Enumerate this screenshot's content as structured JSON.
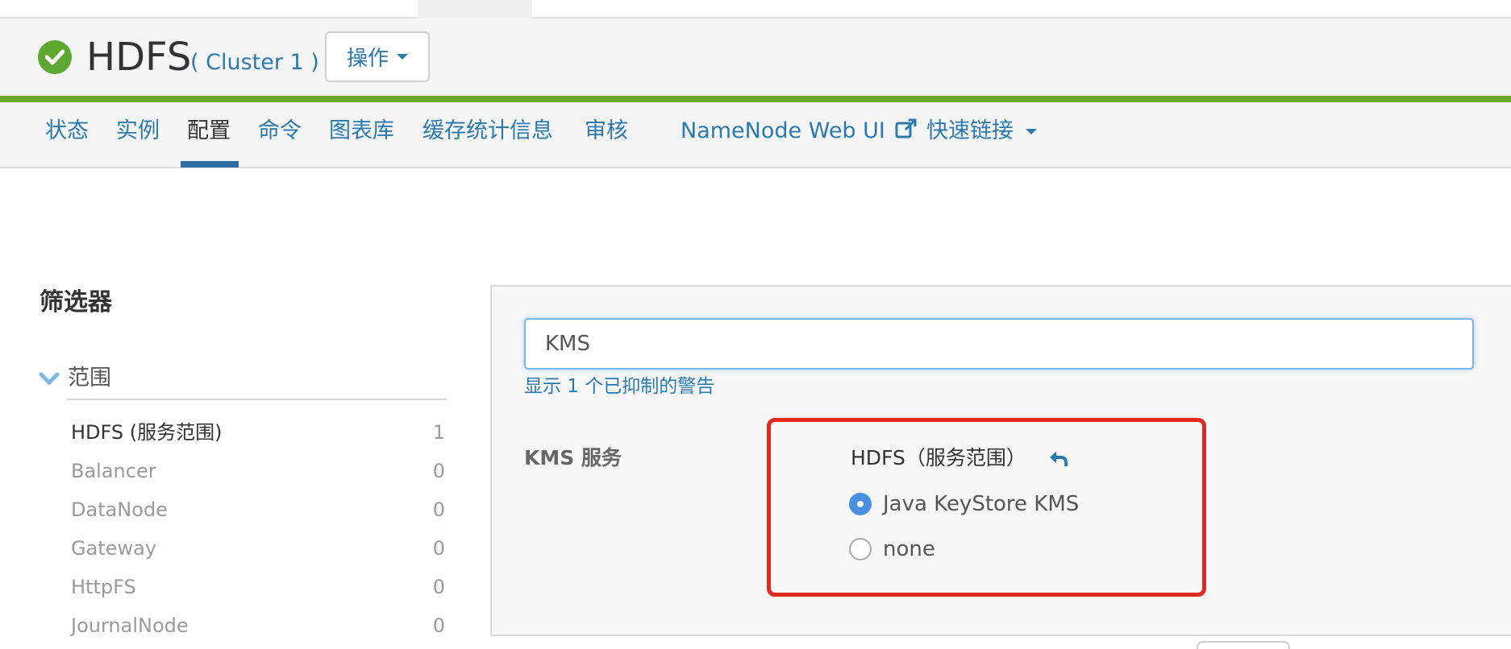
{
  "header": {
    "service_name": "HDFS",
    "cluster_label": "( Cluster 1 )",
    "actions_label": "操作"
  },
  "tabs": [
    {
      "label": "状态"
    },
    {
      "label": "实例"
    },
    {
      "label": "配置"
    },
    {
      "label": "命令"
    },
    {
      "label": "图表库"
    },
    {
      "label": "缓存统计信息"
    },
    {
      "label": "审核"
    },
    {
      "label": "NameNode Web UI"
    },
    {
      "label": "快速链接"
    }
  ],
  "filters": {
    "title": "筛选器",
    "section_label": "范围",
    "items": [
      {
        "name": "HDFS (服务范围)",
        "count": "1"
      },
      {
        "name": "Balancer",
        "count": "0"
      },
      {
        "name": "DataNode",
        "count": "0"
      },
      {
        "name": "Gateway",
        "count": "0"
      },
      {
        "name": "HttpFS",
        "count": "0"
      },
      {
        "name": "JournalNode",
        "count": "0"
      }
    ]
  },
  "search": {
    "value": "KMS"
  },
  "suppressed_warning_link": "显示 1 个已抑制的警告",
  "property": {
    "label": "KMS 服务",
    "scope": "HDFS（服务范围）",
    "options": [
      {
        "label": "Java KeyStore KMS",
        "selected": true
      },
      {
        "label": "none",
        "selected": false
      }
    ]
  },
  "colors": {
    "accent_blue": "#2a7ab0",
    "header_green_bar": "#6ba82e",
    "status_green": "#5ca831",
    "highlight_red": "#e02a20"
  }
}
